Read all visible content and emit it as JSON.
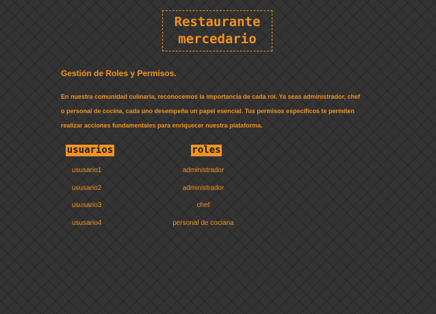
{
  "logo": {
    "text": "Restaurante\nmercedario"
  },
  "page": {
    "heading": "Gestión de Roles y Permisos.",
    "intro": "En nuestra comunidad culinaria, reconocemos la importancia de cada rol. Ya seas administrador, chef o personal de cocina, cada uno desempeña un papel esencial. Tus permisos específicos te permiten realizar acciones fundamentales para enriquecer nuestra plataforma."
  },
  "table": {
    "headers": {
      "users": "usuarios",
      "roles": "roles"
    },
    "rows": [
      {
        "user": "ususario1",
        "role": "administrador"
      },
      {
        "user": "ususario2",
        "role": "administrador"
      },
      {
        "user": "ususario3",
        "role": "chef"
      },
      {
        "user": "ususario4",
        "role": "personal de cociana"
      }
    ]
  },
  "colors": {
    "background": "#333333",
    "accent": "#f29322",
    "header_text": "#1e1e1e"
  }
}
